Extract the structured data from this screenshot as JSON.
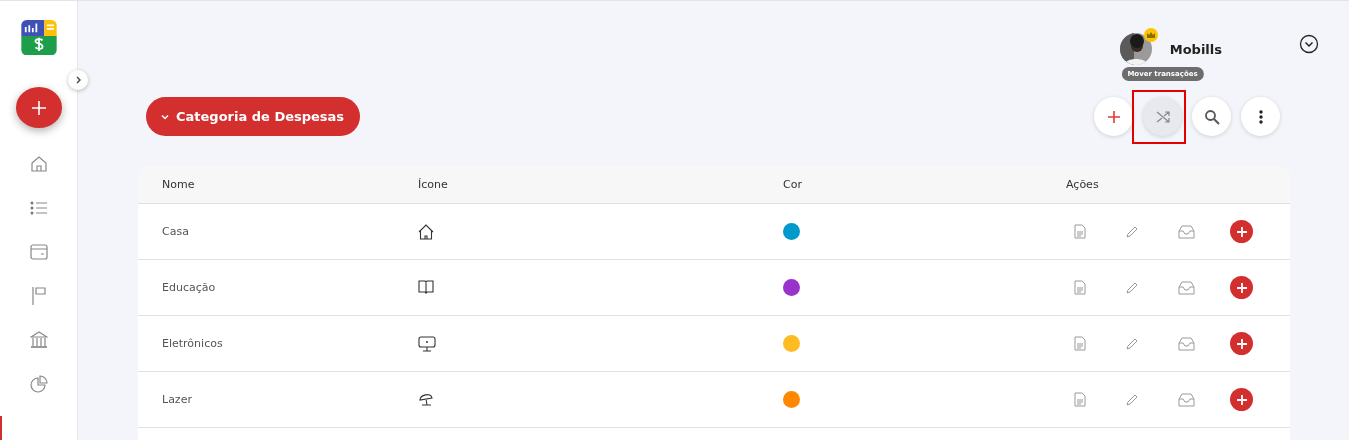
{
  "sidebar": {
    "nav": [
      {
        "selected": false
      },
      {
        "selected": false
      },
      {
        "selected": false
      },
      {
        "selected": false
      },
      {
        "selected": false
      },
      {
        "selected": false
      },
      {
        "selected": true
      }
    ]
  },
  "user": {
    "name": "Mobills",
    "premium": true
  },
  "title_button": {
    "label": "Categoria de Despesas"
  },
  "tooltip": "Mover transações",
  "toolbar": [
    {
      "kind": "add",
      "selected": false
    },
    {
      "kind": "shuffle",
      "selected": true
    },
    {
      "kind": "search",
      "selected": false
    },
    {
      "kind": "more",
      "selected": false
    }
  ],
  "table": {
    "columns": [
      "Nome",
      "Ícone",
      "Cor",
      "Ações"
    ],
    "rows": [
      {
        "name": "Casa",
        "color": "#0099cc"
      },
      {
        "name": "Educação",
        "color": "#9933cc"
      },
      {
        "name": "Eletrônicos",
        "color": "#ffbb22"
      },
      {
        "name": "Lazer",
        "color": "#ff8800"
      }
    ]
  }
}
